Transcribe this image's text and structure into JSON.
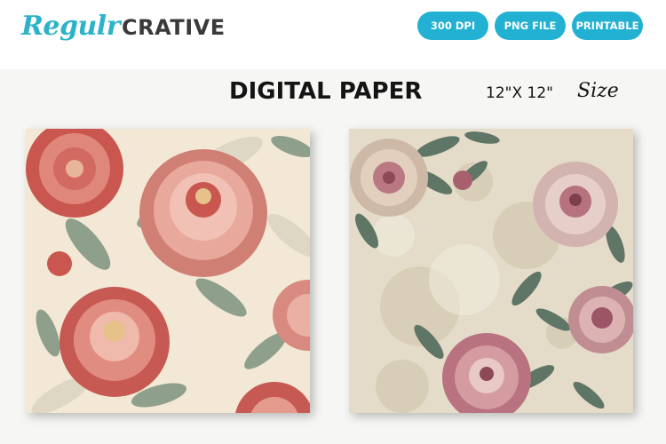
{
  "brand": {
    "script": "Regulr",
    "block": "CRATIVE",
    "colors": {
      "script": "#2cb2c9",
      "block": "#3a3a3a"
    }
  },
  "badges": [
    {
      "label": "300 DPI"
    },
    {
      "label": "PNG FILE"
    },
    {
      "label": "PRINTABLE"
    }
  ],
  "badge_color": "#22b1d2",
  "heading": {
    "title": "DIGITAL PAPER",
    "dimensions": "12\"X 12\"",
    "size_word": "Size"
  },
  "papers": [
    {
      "style": "coral-pink peonies on cream",
      "colors": {
        "bg": "#f3e8d6",
        "flower": "#d9837a",
        "leaf": "#8e9f8c"
      }
    },
    {
      "style": "vintage pink peonies on aged paper",
      "colors": {
        "bg": "#e4dcc8",
        "flower": "#c98e98",
        "leaf": "#5f7566"
      }
    }
  ]
}
